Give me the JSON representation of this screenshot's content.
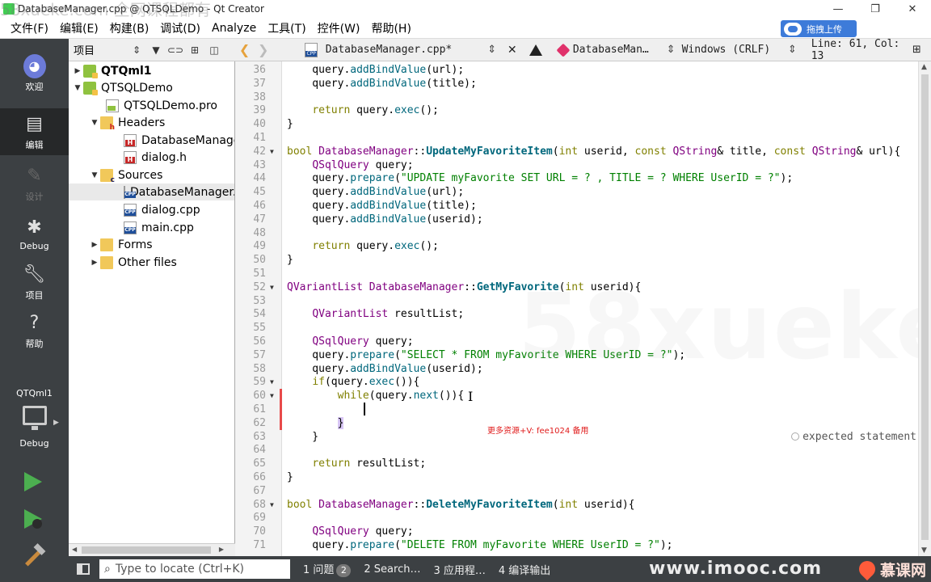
{
  "window": {
    "title": "DatabaseManager.cpp @ QTSQLDemo - Qt Creator",
    "watermark_top": "58xueke.com 全网课程都有",
    "controls": {
      "minimize": "—",
      "maximize": "❐",
      "close": "✕"
    }
  },
  "menu": {
    "items": [
      "文件(F)",
      "编辑(E)",
      "构建(B)",
      "调试(D)",
      "Analyze",
      "工具(T)",
      "控件(W)",
      "帮助(H)"
    ],
    "upload_label": "拖拽上传"
  },
  "modes": [
    {
      "label": "欢迎",
      "icon": "welcome-icon"
    },
    {
      "label": "编辑",
      "icon": "edit-icon",
      "active": true
    },
    {
      "label": "设计",
      "icon": "design-icon",
      "disabled": true
    },
    {
      "label": "Debug",
      "icon": "bug-icon"
    },
    {
      "label": "项目",
      "icon": "wrench-icon"
    },
    {
      "label": "帮助",
      "icon": "help-icon"
    }
  ],
  "kit": {
    "project": "QTQml1",
    "config": "Debug"
  },
  "project_panel": {
    "title": "项目",
    "tree": [
      {
        "label": "QTQml1",
        "bold": true,
        "icon": "qt-project-icon",
        "expanded": false,
        "depth": 0
      },
      {
        "label": "QTSQLDemo",
        "icon": "qt-project-icon",
        "expanded": true,
        "depth": 0
      },
      {
        "label": "QTSQLDemo.pro",
        "icon": "pro-file-icon",
        "depth": 1
      },
      {
        "label": "Headers",
        "icon": "headers-folder-icon",
        "expanded": true,
        "depth": 1
      },
      {
        "label": "DatabaseManager.h",
        "icon": "header-file-icon",
        "depth": 2
      },
      {
        "label": "dialog.h",
        "icon": "header-file-icon",
        "depth": 2
      },
      {
        "label": "Sources",
        "icon": "sources-folder-icon",
        "expanded": true,
        "depth": 1
      },
      {
        "label": "DatabaseManager.cpp",
        "icon": "cpp-file-icon",
        "depth": 2,
        "selected": true
      },
      {
        "label": "dialog.cpp",
        "icon": "cpp-file-icon",
        "depth": 2
      },
      {
        "label": "main.cpp",
        "icon": "cpp-file-icon",
        "depth": 2
      },
      {
        "label": "Forms",
        "icon": "folder-icon",
        "expanded": false,
        "depth": 1
      },
      {
        "label": "Other files",
        "icon": "folder-icon",
        "expanded": false,
        "depth": 1
      }
    ]
  },
  "editor_toolbar": {
    "filename": "DatabaseManager.cpp*",
    "symbol": "DatabaseMan…",
    "encoding": "Windows (CRLF)",
    "position": "Line: 61, Col: 13"
  },
  "code": [
    {
      "n": "36",
      "t": [
        [
          "    query.",
          ""
        ],
        [
          "addBindValue",
          "fn"
        ],
        [
          "(url);",
          ""
        ]
      ]
    },
    {
      "n": "37",
      "t": [
        [
          "    query.",
          ""
        ],
        [
          "addBindValue",
          "fn"
        ],
        [
          "(title);",
          ""
        ]
      ]
    },
    {
      "n": "38",
      "t": []
    },
    {
      "n": "39",
      "t": [
        [
          "    ",
          ""
        ],
        [
          "return",
          "kw"
        ],
        [
          " query.",
          ""
        ],
        [
          "exec",
          "fn"
        ],
        [
          "();",
          ""
        ]
      ]
    },
    {
      "n": "40",
      "t": [
        [
          "}",
          ""
        ]
      ]
    },
    {
      "n": "41",
      "t": []
    },
    {
      "n": "42",
      "fold": true,
      "t": [
        [
          "bool",
          "kw"
        ],
        [
          " ",
          ""
        ],
        [
          "DatabaseManager",
          "ty"
        ],
        [
          "::",
          ""
        ],
        [
          "UpdateMyFavoriteItem",
          "fnb"
        ],
        [
          "(",
          ""
        ],
        [
          "int",
          "kw"
        ],
        [
          " userid, ",
          ""
        ],
        [
          "const",
          "kw"
        ],
        [
          " ",
          ""
        ],
        [
          "QString",
          "ty"
        ],
        [
          "& title, ",
          ""
        ],
        [
          "const",
          "kw"
        ],
        [
          " ",
          ""
        ],
        [
          "QString",
          "ty"
        ],
        [
          "& url){",
          ""
        ]
      ]
    },
    {
      "n": "43",
      "t": [
        [
          "    ",
          ""
        ],
        [
          "QSqlQuery",
          "ty"
        ],
        [
          " query;",
          ""
        ]
      ]
    },
    {
      "n": "44",
      "t": [
        [
          "    query.",
          ""
        ],
        [
          "prepare",
          "fn"
        ],
        [
          "(",
          ""
        ],
        [
          "\"UPDATE myFavorite SET URL = ? , TITLE = ? WHERE UserID = ?\"",
          "st"
        ],
        [
          ");",
          ""
        ]
      ]
    },
    {
      "n": "45",
      "t": [
        [
          "    query.",
          ""
        ],
        [
          "addBindValue",
          "fn"
        ],
        [
          "(url);",
          ""
        ]
      ]
    },
    {
      "n": "46",
      "t": [
        [
          "    query.",
          ""
        ],
        [
          "addBindValue",
          "fn"
        ],
        [
          "(title);",
          ""
        ]
      ]
    },
    {
      "n": "47",
      "t": [
        [
          "    query.",
          ""
        ],
        [
          "addBindValue",
          "fn"
        ],
        [
          "(userid);",
          ""
        ]
      ]
    },
    {
      "n": "48",
      "t": []
    },
    {
      "n": "49",
      "t": [
        [
          "    ",
          ""
        ],
        [
          "return",
          "kw"
        ],
        [
          " query.",
          ""
        ],
        [
          "exec",
          "fn"
        ],
        [
          "();",
          ""
        ]
      ]
    },
    {
      "n": "50",
      "t": [
        [
          "}",
          ""
        ]
      ]
    },
    {
      "n": "51",
      "t": []
    },
    {
      "n": "52",
      "fold": true,
      "t": [
        [
          "QVariantList",
          "ty"
        ],
        [
          " ",
          ""
        ],
        [
          "DatabaseManager",
          "ty"
        ],
        [
          "::",
          ""
        ],
        [
          "GetMyFavorite",
          "fnb"
        ],
        [
          "(",
          ""
        ],
        [
          "int",
          "kw"
        ],
        [
          " userid){",
          ""
        ]
      ]
    },
    {
      "n": "53",
      "t": []
    },
    {
      "n": "54",
      "t": [
        [
          "    ",
          ""
        ],
        [
          "QVariantList",
          "ty"
        ],
        [
          " resultList;",
          ""
        ]
      ]
    },
    {
      "n": "55",
      "t": []
    },
    {
      "n": "56",
      "t": [
        [
          "    ",
          ""
        ],
        [
          "QSqlQuery",
          "ty"
        ],
        [
          " query;",
          ""
        ]
      ]
    },
    {
      "n": "57",
      "t": [
        [
          "    query.",
          ""
        ],
        [
          "prepare",
          "fn"
        ],
        [
          "(",
          ""
        ],
        [
          "\"SELECT * FROM myFavorite WHERE UserID = ?\"",
          "st"
        ],
        [
          ");",
          ""
        ]
      ]
    },
    {
      "n": "58",
      "t": [
        [
          "    query.",
          ""
        ],
        [
          "addBindValue",
          "fn"
        ],
        [
          "(userid);",
          ""
        ]
      ]
    },
    {
      "n": "59",
      "fold": true,
      "t": [
        [
          "    ",
          ""
        ],
        [
          "if",
          "kw"
        ],
        [
          "(query.",
          ""
        ],
        [
          "exec",
          "fn"
        ],
        [
          "()){",
          ""
        ]
      ]
    },
    {
      "n": "60",
      "fold": true,
      "t": [
        [
          "        ",
          ""
        ],
        [
          "while",
          "kw"
        ],
        [
          "(query.",
          ""
        ],
        [
          "next",
          "fn"
        ],
        [
          "()){",
          ""
        ]
      ]
    },
    {
      "n": "61",
      "t": []
    },
    {
      "n": "62",
      "t": [
        [
          "        ",
          ""
        ],
        [
          "}",
          "brace"
        ]
      ]
    },
    {
      "n": "63",
      "t": [
        [
          "    }",
          ""
        ]
      ]
    },
    {
      "n": "64",
      "t": []
    },
    {
      "n": "65",
      "t": [
        [
          "    ",
          ""
        ],
        [
          "return",
          "kw"
        ],
        [
          " resultList;",
          ""
        ]
      ]
    },
    {
      "n": "66",
      "t": [
        [
          "}",
          ""
        ]
      ]
    },
    {
      "n": "67",
      "t": []
    },
    {
      "n": "68",
      "fold": true,
      "t": [
        [
          "bool",
          "kw"
        ],
        [
          " ",
          ""
        ],
        [
          "DatabaseManager",
          "ty"
        ],
        [
          "::",
          ""
        ],
        [
          "DeleteMyFavoriteItem",
          "fnb"
        ],
        [
          "(",
          ""
        ],
        [
          "int",
          "kw"
        ],
        [
          " userid){",
          ""
        ]
      ]
    },
    {
      "n": "69",
      "t": []
    },
    {
      "n": "70",
      "t": [
        [
          "    ",
          ""
        ],
        [
          "QSqlQuery",
          "ty"
        ],
        [
          " query;",
          ""
        ]
      ]
    },
    {
      "n": "71",
      "t": [
        [
          "    query.",
          ""
        ],
        [
          "prepare",
          "fn"
        ],
        [
          "(",
          ""
        ],
        [
          "\"DELETE FROM myFavorite WHERE UserID = ?\"",
          "st"
        ],
        [
          ");",
          ""
        ]
      ]
    }
  ],
  "annotation": "更多资源+V: fee1024 备用",
  "diagnostic": "expected statement",
  "statusbar": {
    "locator_placeholder": "Type to locate (Ctrl+K)",
    "panes": [
      {
        "label": "1  问题",
        "badge": "2"
      },
      {
        "label": "2  Search…"
      },
      {
        "label": "3  应用程…"
      },
      {
        "label": "4  编译输出"
      }
    ],
    "brand_url": "www.imooc.com",
    "brand_name": "慕课网"
  },
  "colors": {
    "sidebar": "#3c4043",
    "keyword": "#808000",
    "type": "#800080",
    "function": "#00677c",
    "string": "#008000",
    "accent": "#3d7bd9"
  }
}
